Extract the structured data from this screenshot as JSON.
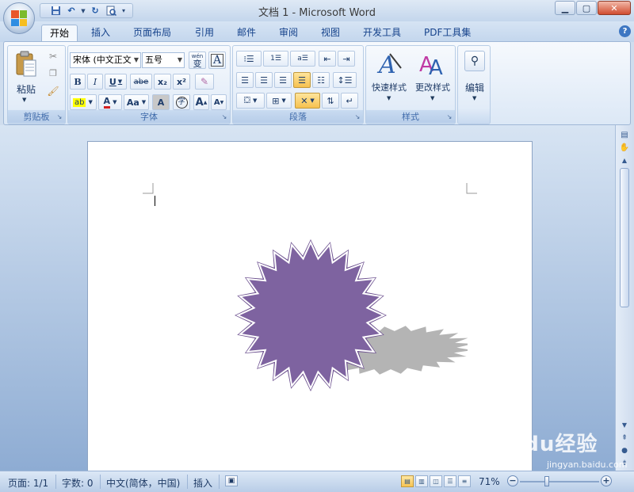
{
  "window": {
    "title": "文档 1 - Microsoft Word"
  },
  "qat": {
    "icons": [
      "save-icon",
      "undo-icon",
      "redo-icon",
      "print-preview-icon",
      "customize-icon"
    ]
  },
  "tabs": [
    {
      "label": "开始",
      "active": true
    },
    {
      "label": "插入"
    },
    {
      "label": "页面布局"
    },
    {
      "label": "引用"
    },
    {
      "label": "邮件"
    },
    {
      "label": "审阅"
    },
    {
      "label": "视图"
    },
    {
      "label": "开发工具"
    },
    {
      "label": "PDF工具集"
    }
  ],
  "ribbon": {
    "clipboard": {
      "label": "剪贴板",
      "paste_label": "粘贴"
    },
    "font": {
      "label": "字体",
      "font_name": "宋体 (中文正文",
      "font_size": "五号",
      "wen_label": "wén",
      "wen_char": "变",
      "A_label": "A",
      "bold": "B",
      "italic": "I",
      "underline": "U",
      "strike": "abe",
      "sub": "x₂",
      "sup": "x²",
      "font_color": "A",
      "change_case": "Aa",
      "char_shade": "A",
      "enclose": "字",
      "grow": "A",
      "shrink": "A"
    },
    "paragraph": {
      "label": "段落"
    },
    "styles": {
      "label": "样式",
      "quick_styles": "快速样式",
      "change_styles": "更改样式"
    },
    "editing": {
      "label": "编辑"
    }
  },
  "status": {
    "page": "页面: 1/1",
    "words": "字数: 0",
    "language": "中文(简体，中国)",
    "mode": "插入",
    "zoom": "71%",
    "zoom_level": 0.71
  },
  "watermark": {
    "brand": "Baidu经验",
    "url": "jingyan.baidu.com"
  },
  "colors": {
    "shape_fill": "#7e63a0",
    "shape_outline": "#ffffff",
    "shape_border": "#6c508f",
    "shadow": "#b4b4b4"
  }
}
